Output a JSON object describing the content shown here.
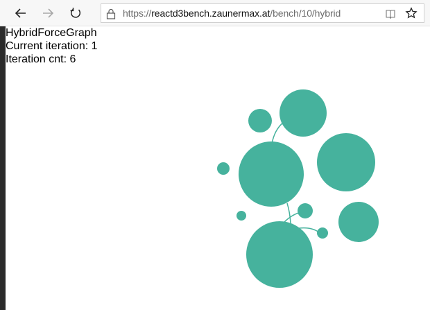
{
  "browser": {
    "url_prefix": "https://",
    "url_host": "reactd3bench.zaunermax.at",
    "url_path": "/bench/10/hybrid",
    "icons": [
      "back-arrow-icon",
      "forward-arrow-icon",
      "refresh-icon",
      "lock-icon",
      "reading-view-icon",
      "favorite-star-icon"
    ]
  },
  "page": {
    "title": "HybridForceGraph",
    "current_iteration_label": "Current iteration:",
    "current_iteration": "1",
    "iteration_cnt_label": "Iteration cnt:",
    "iteration_cnt": "6"
  },
  "colors": {
    "node": "#46b29d",
    "link": "#46b29d"
  },
  "graph": {
    "node_count": 12,
    "link_count": 4
  }
}
